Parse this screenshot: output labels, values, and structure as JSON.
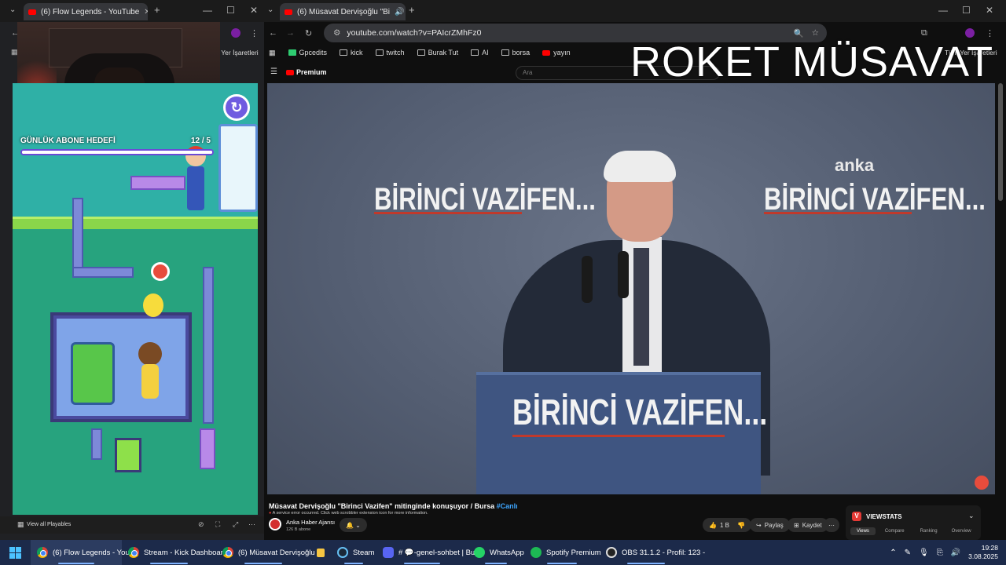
{
  "left_window": {
    "tab_title": "(6) Flow Legends - YouTube",
    "bookmarks_partial": "m Yer İşaretleri",
    "subscriber_goal": {
      "label": "GÜNLÜK ABONE HEDEFİ",
      "count": "12 / 5",
      "progress": 1.0
    },
    "view_all_label": "View all Playables"
  },
  "right_window": {
    "tab_title": "(6) Müsavat Dervişoğlu \"Bi",
    "url": "youtube.com/watch?v=PAIcrZMhFz0",
    "bookmarks": [
      "Gpcedits",
      "kick",
      "twitch",
      "Burak Tut",
      "AI",
      "borsa",
      "yayın"
    ],
    "bookmarks_right_partial": "Tüm Yer İşaretleri",
    "overlay_title": "ROKET MÜSAVAT",
    "youtube_logo": "Premium",
    "search_placeholder": "Ara",
    "video": {
      "sign_text": "BİRİNCİ VAZİFEN...",
      "watermark": "anka"
    },
    "video_title": "Müsavat Dervişoğlu \"Birinci Vazifen\" mitinginde konuşuyor / Bursa",
    "live_tag": "#Canlı",
    "error_text": "A service error occurred. Click web scrobbler extension icon for more information.",
    "channel_name": "Anka Haber Ajansı",
    "channel_subs": "126 B abone",
    "likes": "1 B",
    "share_label": "Paylaş",
    "save_label": "Kaydet",
    "viewstats": {
      "title": "VIEWSTATS",
      "tabs": [
        "Views",
        "Compare",
        "Ranking",
        "Overview"
      ]
    }
  },
  "taskbar": {
    "items": [
      "(6) Flow Legends - YouT",
      "Stream - Kick Dashboar",
      "(6) Müsavat Dervişoğlu",
      "Steam",
      "# 💬-genel-sohbet | Bur",
      "WhatsApp",
      "Spotify Premium",
      "OBS 31.1.2 - Profil: 123 -"
    ],
    "time": "19:28",
    "date": "3.08.2025"
  }
}
